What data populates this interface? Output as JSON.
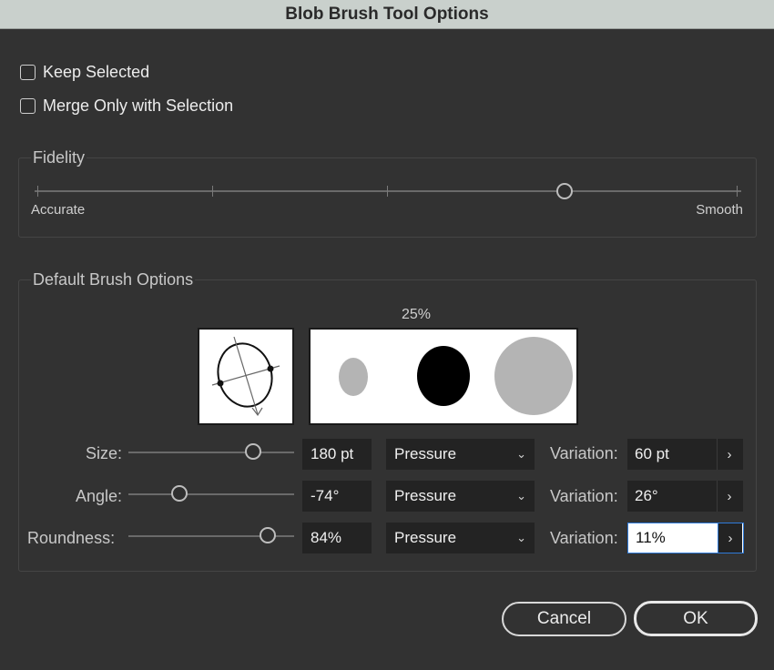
{
  "window": {
    "title": "Blob Brush Tool Options"
  },
  "options": {
    "keep_selected": {
      "label": "Keep Selected",
      "checked": false
    },
    "merge_only": {
      "label": "Merge Only with Selection",
      "checked": false
    }
  },
  "fidelity": {
    "title": "Fidelity",
    "min_label": "Accurate",
    "max_label": "Smooth",
    "value": 0.75
  },
  "brush": {
    "title": "Default Brush Options",
    "preview_percent": "25%",
    "rows": [
      {
        "label": "Size:",
        "slider_value": 0.75,
        "field": "180 pt",
        "mode": "Pressure",
        "variation_label": "Variation:",
        "variation": "60 pt"
      },
      {
        "label": "Angle:",
        "slider_value": 0.31,
        "field": "-74°",
        "mode": "Pressure",
        "variation_label": "Variation:",
        "variation": "26°"
      },
      {
        "label": "Roundness:",
        "slider_value": 0.84,
        "field": "84%",
        "mode": "Pressure",
        "variation_label": "Variation:",
        "variation": "11%"
      }
    ]
  },
  "icons": {
    "chevron": "chevron-down-icon",
    "arrow": "chevron-right-icon"
  },
  "buttons": {
    "cancel": "Cancel",
    "ok": "OK"
  },
  "colors": {
    "focus": "#2f7ad8",
    "dialog_bg": "#323232",
    "titlebar": "#c9d0cc"
  }
}
